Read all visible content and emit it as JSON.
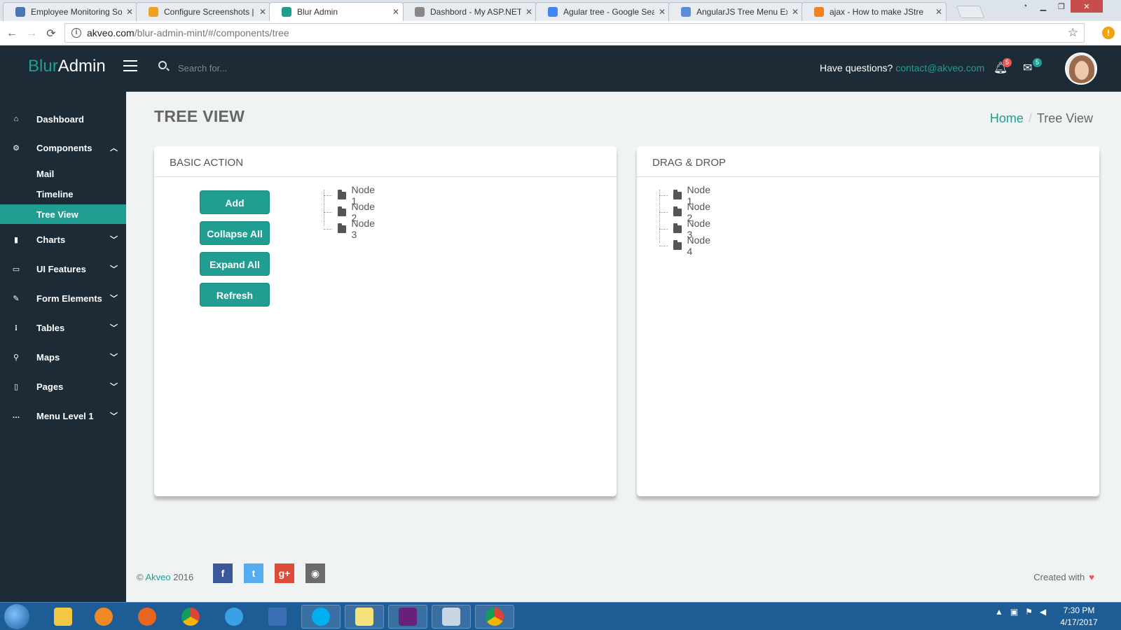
{
  "browser": {
    "tabs": [
      {
        "label": "Employee Monitoring So",
        "color": "#4a77b4"
      },
      {
        "label": "Configure Screenshots | A",
        "color": "#f0a020"
      },
      {
        "label": "Blur Admin",
        "color": "#209e91"
      },
      {
        "label": "Dashbord - My ASP.NET",
        "color": "#888888"
      },
      {
        "label": "Agular tree - Google Sea",
        "color": "#4285f4"
      },
      {
        "label": "AngularJS Tree Menu Exa",
        "color": "#5a8dd6"
      },
      {
        "label": "ajax - How to make JStre",
        "color": "#f48024"
      }
    ],
    "url_host": "akveo.com",
    "url_path": "/blur-admin-mint/#/components/tree",
    "back": "←",
    "forward": "→",
    "reload": "⟳",
    "star": "☆",
    "alert": "!"
  },
  "header": {
    "logo_a": "Blur",
    "logo_b": "Admin",
    "search_placeholder": "Search for...",
    "questions_text": "Have questions?",
    "contact": "contact@akveo.com",
    "notif_count": "5",
    "msg_count": "5",
    "accent": "#209e91",
    "notif_badge_color": "#e85656"
  },
  "sidebar": {
    "items": [
      {
        "icon": "⌂",
        "label": "Dashboard"
      },
      {
        "icon": "⚙",
        "label": "Components",
        "expanded": true
      },
      {
        "icon": "▮",
        "label": "Charts"
      },
      {
        "icon": "▭",
        "label": "UI Features"
      },
      {
        "icon": "✎",
        "label": "Form Elements"
      },
      {
        "icon": "⁝",
        "label": "Tables"
      },
      {
        "icon": "⚲",
        "label": "Maps"
      },
      {
        "icon": "▯",
        "label": "Pages"
      },
      {
        "icon": "…",
        "label": "Menu Level 1"
      }
    ],
    "sub_items": [
      {
        "label": "Mail"
      },
      {
        "label": "Timeline"
      },
      {
        "label": "Tree View",
        "active": true
      }
    ]
  },
  "page": {
    "title": "TREE VIEW",
    "breadcrumb_home": "Home",
    "breadcrumb_sep": "/",
    "breadcrumb_current": "Tree View"
  },
  "basic_panel": {
    "title": "BASIC ACTION",
    "buttons": {
      "add": "Add",
      "collapse": "Collapse All",
      "expand": "Expand All",
      "refresh": "Refresh"
    },
    "nodes": [
      "Node 1",
      "Node 2",
      "Node 3"
    ]
  },
  "dnd_panel": {
    "title": "DRAG & DROP",
    "nodes": [
      "Node 1",
      "Node 2",
      "Node 3",
      "Node 4"
    ]
  },
  "footer": {
    "copyright": "©",
    "company": "Akveo",
    "year": "2016",
    "created_with": "Created with",
    "heart": "♥",
    "social": [
      {
        "name": "facebook",
        "glyph": "f",
        "color": "#3b5998"
      },
      {
        "name": "twitter",
        "glyph": "t",
        "color": "#55acee"
      },
      {
        "name": "google-plus",
        "glyph": "g+",
        "color": "#dd4b39"
      },
      {
        "name": "github",
        "glyph": "◉",
        "color": "#6b6b6b"
      }
    ]
  },
  "taskbar": {
    "time": "7:30 PM",
    "date": "4/17/2017",
    "apps": [
      {
        "name": "explorer",
        "color": "#f2c744"
      },
      {
        "name": "media-player",
        "color": "#f08a24"
      },
      {
        "name": "firefox",
        "color": "#e8661f"
      },
      {
        "name": "chrome",
        "color": "#4c9d4f"
      },
      {
        "name": "internet-explorer",
        "color": "#3ba0e6"
      },
      {
        "name": "remote-desktop",
        "color": "#3a6fb5"
      },
      {
        "name": "skype",
        "color": "#00aff0"
      },
      {
        "name": "sticky-notes",
        "color": "#f5e27a"
      },
      {
        "name": "visual-studio",
        "color": "#68217a"
      },
      {
        "name": "snipping-tool",
        "color": "#c9d6e3"
      },
      {
        "name": "chrome-active",
        "color": "#4c9d4f"
      }
    ]
  }
}
